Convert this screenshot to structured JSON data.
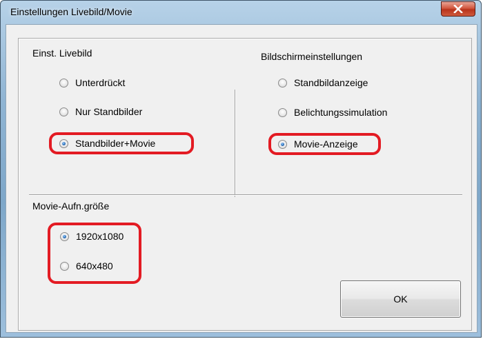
{
  "window": {
    "title": "Einstellungen Livebild/Movie",
    "close_symbol": "X"
  },
  "live_view": {
    "heading": "Einst. Livebild",
    "options": [
      {
        "label": "Unterdrückt",
        "checked": false
      },
      {
        "label": "Nur Standbilder",
        "checked": false
      },
      {
        "label": "Standbilder+Movie",
        "checked": true
      }
    ]
  },
  "screen_settings": {
    "heading": "Bildschirmeinstellungen",
    "options": [
      {
        "label": "Standbildanzeige",
        "checked": false
      },
      {
        "label": "Belichtungssimulation",
        "checked": false
      },
      {
        "label": "Movie-Anzeige",
        "checked": true
      }
    ]
  },
  "movie_size": {
    "heading": "Movie-Aufn.größe",
    "options": [
      {
        "label": "1920x1080",
        "checked": true
      },
      {
        "label": "640x480",
        "checked": false
      }
    ]
  },
  "buttons": {
    "ok_label": "OK"
  },
  "colors": {
    "highlight": "#e31b23",
    "dialog_background": "#f0f0f0",
    "close_button": "#c8462d"
  }
}
